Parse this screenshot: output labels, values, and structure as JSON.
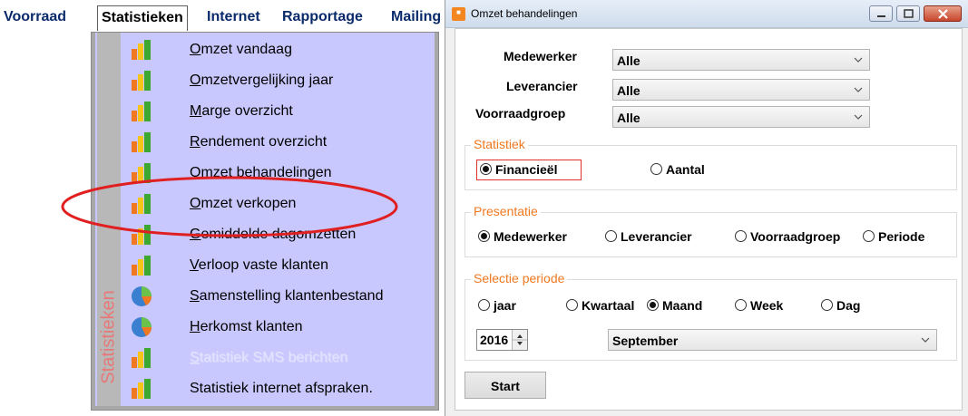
{
  "menubar": {
    "items": [
      "Voorraad",
      "Statistieken",
      "Internet",
      "Rapportage",
      "Mailing"
    ]
  },
  "dropdown": {
    "side_label": "Statistieken",
    "items": [
      {
        "label": "Omzet vandaag",
        "accel": "O",
        "rest": "mzet vandaag",
        "icon": "bar-chart-icon",
        "enabled": true
      },
      {
        "label": "Omzetvergelijking jaar",
        "accel": "O",
        "rest": "mzetvergelijking jaar",
        "icon": "bar-chart-icon",
        "enabled": true
      },
      {
        "label": "Marge overzicht",
        "accel": "M",
        "rest": "arge overzicht",
        "icon": "bar-chart-icon",
        "enabled": true
      },
      {
        "label": "Rendement overzicht",
        "accel": "R",
        "rest": "endement overzicht",
        "icon": "bar-chart-icon",
        "enabled": true
      },
      {
        "label": "Omzet behandelingen",
        "accel": "O",
        "rest": "mzet behandelingen",
        "icon": "bar-chart-icon",
        "enabled": true
      },
      {
        "label": "Omzet verkopen",
        "accel": "O",
        "rest": "mzet verkopen",
        "icon": "bar-chart-icon",
        "enabled": true
      },
      {
        "label": "Gemiddelde dagomzetten",
        "accel": "G",
        "rest": "emiddelde dagomzetten",
        "icon": "bar-chart-icon",
        "enabled": true
      },
      {
        "label": "Verloop vaste klanten",
        "accel": "V",
        "rest": "erloop vaste klanten",
        "icon": "bar-chart-icon",
        "enabled": true
      },
      {
        "label": "Samenstelling klantenbestand",
        "accel": "S",
        "rest": "amenstelling klantenbestand",
        "icon": "pie-chart-icon",
        "enabled": true
      },
      {
        "label": "Herkomst klanten",
        "accel": "H",
        "rest": "erkomst klanten",
        "icon": "pie-chart-icon",
        "enabled": true
      },
      {
        "label": "Statistiek SMS berichten",
        "accel": "S",
        "rest": "tatistiek SMS berichten",
        "icon": "bar-chart-icon",
        "enabled": false
      },
      {
        "label": "Statistiek internet afspraken.",
        "accel": "",
        "rest": "Statistiek internet afspraken.",
        "icon": "bar-chart-icon",
        "enabled": true
      }
    ]
  },
  "dialog": {
    "title": "Omzet behandelingen",
    "fields": [
      {
        "label": "Medewerker",
        "value": "Alle"
      },
      {
        "label": "Leverancier",
        "value": "Alle"
      },
      {
        "label": "Voorraadgroep",
        "value": "Alle"
      }
    ],
    "statistiek": {
      "title": "Statistiek",
      "options": [
        {
          "label": "Financieël",
          "selected": true
        },
        {
          "label": "Aantal",
          "selected": false
        }
      ]
    },
    "presentatie": {
      "title": "Presentatie",
      "options": [
        {
          "label": "Medewerker",
          "selected": true
        },
        {
          "label": "Leverancier",
          "selected": false
        },
        {
          "label": "Voorraadgroep",
          "selected": false
        },
        {
          "label": "Periode",
          "selected": false
        }
      ]
    },
    "selectie": {
      "title": "Selectie periode",
      "options": [
        {
          "label": "jaar",
          "selected": false
        },
        {
          "label": "Kwartaal",
          "selected": false
        },
        {
          "label": "Maand",
          "selected": true
        },
        {
          "label": "Week",
          "selected": false
        },
        {
          "label": "Dag",
          "selected": false
        }
      ],
      "year": "2016",
      "month": "September"
    },
    "start_label": "Start"
  },
  "colors": {
    "menu_bg": "#c8c8ff",
    "group_title": "#f07820",
    "highlight": "#e03030",
    "side_label": "#e87878"
  }
}
